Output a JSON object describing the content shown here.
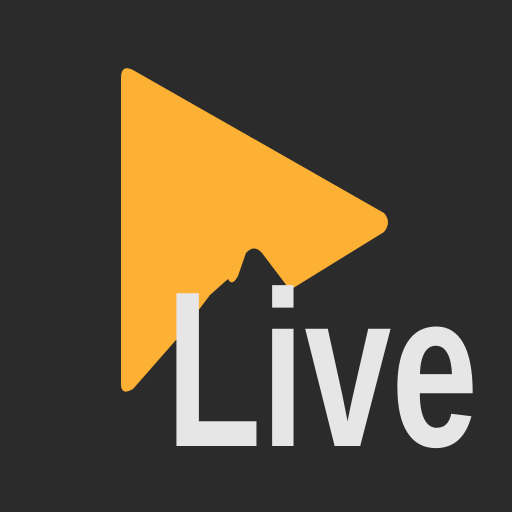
{
  "logo": {
    "wordmark": "Live",
    "icon_name": "play-icon"
  },
  "colors": {
    "background": "#2b2b2b",
    "play_accent": "#fcb034",
    "wordmark": "#e6e6e6"
  }
}
